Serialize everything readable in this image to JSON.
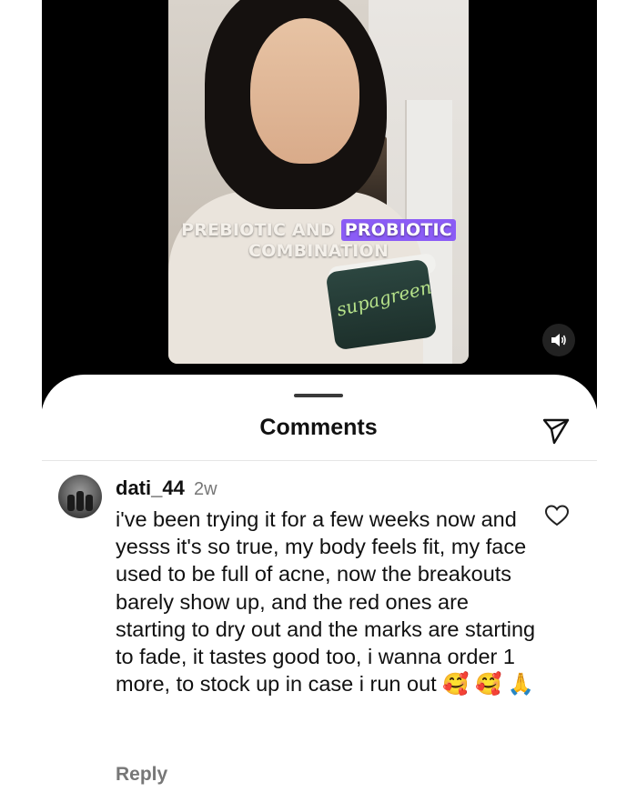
{
  "video": {
    "caption_part1": "PREBIOTIC AND",
    "caption_highlight": "PROBIOTIC",
    "caption_line2": "COMBINATION",
    "jar_brand": "supagreen",
    "sound_icon": "speaker-icon"
  },
  "comments_sheet": {
    "title": "Comments",
    "share_icon": "send-icon"
  },
  "comment": {
    "username": "dati_44",
    "timestamp": "2w",
    "text": "i've been trying it for a few weeks now and yesss it's so true, my body feels fit, my face used to be full of acne, now the breakouts barely show up, and the red ones are starting to dry out and the marks are starting to fade, it tastes good too, i wanna order 1 more, to stock up in case i run out 🥰 🥰 🙏",
    "like_icon": "heart-icon",
    "reply_label": "Reply"
  },
  "colors": {
    "caption_highlight": "#8b5cf6",
    "video_background": "#000000",
    "muted_text": "#777777"
  }
}
